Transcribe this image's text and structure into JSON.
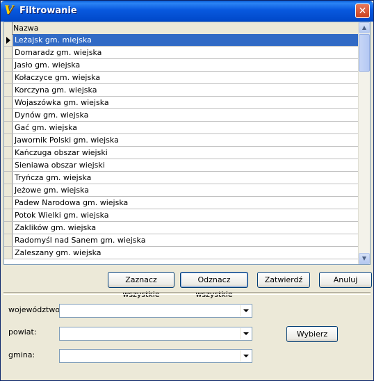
{
  "window": {
    "title": "Filtrowanie",
    "close_glyph": "✕",
    "icon": "app-logo-icon"
  },
  "grid": {
    "column_header": "Nazwa",
    "selected_index": 0,
    "rows": [
      "Leżajsk gm. miejska",
      "Domaradz gm. wiejska",
      "Jasło gm. wiejska",
      "Kołaczyce gm. wiejska",
      "Korczyna gm. wiejska",
      "Wojaszówka gm. wiejska",
      "Dynów gm. wiejska",
      "Gać gm. wiejska",
      "Jawornik Polski gm. wiejska",
      "Kańczuga obszar wiejski",
      "Sieniawa obszar wiejski",
      "Tryńcza gm. wiejska",
      "Jeżowe gm. wiejska",
      "Padew Narodowa gm. wiejska",
      "Potok Wielki gm. wiejska",
      "Zaklików gm. wiejska",
      "Radomyśl nad Sanem gm. wiejska",
      "Zaleszany gm. wiejska"
    ]
  },
  "buttons": {
    "select_all": "Zaznacz wszystkie",
    "deselect_all": "Odznacz wszystkie",
    "confirm": "Zatwierdź",
    "cancel": "Anuluj",
    "choose": "Wybierz"
  },
  "filters": {
    "voivodeship_label": "województwo:",
    "voivodeship_value": "",
    "county_label": "powiat:",
    "county_value": "",
    "commune_label": "gmina:",
    "commune_value": ""
  }
}
